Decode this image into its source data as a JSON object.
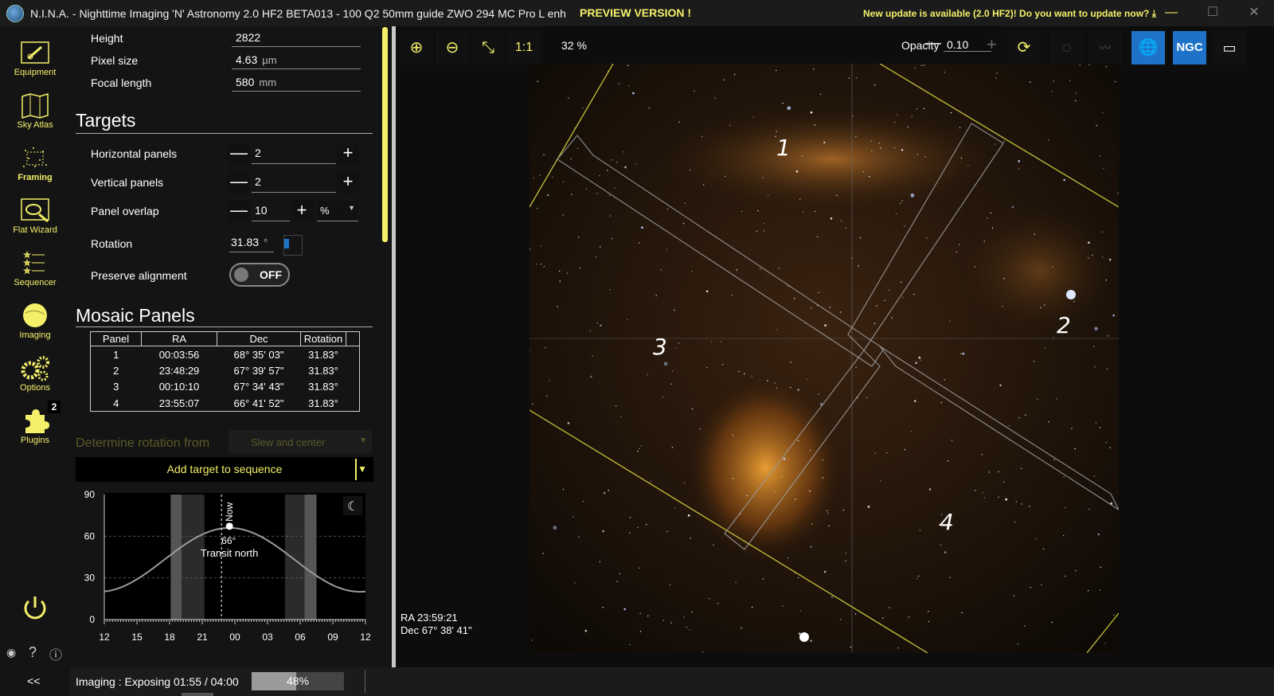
{
  "titlebar": {
    "title": "N.I.N.A. - Nighttime Imaging 'N' Astronomy 2.0 HF2 BETA013  -  100 Q2 50mm guide ZWO 294 MC Pro L enh",
    "preview": "PREVIEW VERSION !",
    "update": "New update is available (2.0 HF2)! Do you want to update now? ⤓",
    "minimize": "—",
    "maximize": "☐",
    "close": "✕"
  },
  "nav": {
    "items": [
      {
        "label": "Equipment"
      },
      {
        "label": "Sky Atlas"
      },
      {
        "label": "Framing"
      },
      {
        "label": "Flat Wizard"
      },
      {
        "label": "Sequencer"
      },
      {
        "label": "Imaging"
      },
      {
        "label": "Options"
      },
      {
        "label": "Plugins",
        "badge": "2"
      }
    ],
    "collapse": "<<"
  },
  "camera": {
    "height_label": "Height",
    "height_value": "2822",
    "pixel_label": "Pixel size",
    "pixel_value": "4.63",
    "pixel_unit": "µm",
    "focal_label": "Focal length",
    "focal_value": "580",
    "focal_unit": "mm"
  },
  "targets": {
    "title": "Targets",
    "hpanels_label": "Horizontal panels",
    "hpanels_value": "2",
    "vpanels_label": "Vertical panels",
    "vpanels_value": "2",
    "overlap_label": "Panel overlap",
    "overlap_value": "10",
    "overlap_unit": "%",
    "rotation_label": "Rotation",
    "rotation_value": "31.83",
    "rotation_unit": "°",
    "preserve_label": "Preserve alignment",
    "preserve_value": "OFF",
    "minus": "—",
    "plus": "+"
  },
  "mosaic": {
    "title": "Mosaic Panels",
    "headers": [
      "Panel",
      "RA",
      "Dec",
      "Rotation"
    ],
    "rows": [
      [
        "1",
        "00:03:56",
        "68° 35' 03\"",
        "31.83°"
      ],
      [
        "2",
        "23:48:29",
        "67° 39' 57\"",
        "31.83°"
      ],
      [
        "3",
        "00:10:10",
        "67° 34' 43\"",
        "31.83°"
      ],
      [
        "4",
        "23:55:07",
        "66° 41' 52\"",
        "31.83°"
      ]
    ]
  },
  "actions": {
    "determine_label": "Determine rotation from",
    "determine_value": "Slew and center",
    "add_target": "Add target to sequence"
  },
  "chart_data": {
    "type": "line",
    "title": "",
    "xlabel": "",
    "ylabel": "",
    "x_ticks": [
      "12",
      "15",
      "18",
      "21",
      "00",
      "03",
      "06",
      "09",
      "12"
    ],
    "y_ticks": [
      "90",
      "60",
      "30",
      "0"
    ],
    "ylim": [
      0,
      90
    ],
    "series": [
      {
        "values": [
          [
            12,
            21
          ],
          [
            15,
            30
          ],
          [
            18,
            45
          ],
          [
            21,
            60
          ],
          [
            23.5,
            66
          ],
          [
            2,
            60
          ],
          [
            5,
            45
          ],
          [
            8,
            30
          ],
          [
            11,
            21
          ],
          [
            12,
            20
          ]
        ]
      }
    ],
    "annotations": {
      "now": "Now",
      "altitude": "66°",
      "transit": "Transit north"
    },
    "moon_icon": "moon-icon"
  },
  "status": {
    "text": "Imaging :   Exposing 01:55 / 04:00",
    "progress": 0.48,
    "progress_text": "48%"
  },
  "viewer": {
    "zoom_in": "⊕",
    "zoom_out": "⊖",
    "fit": "⤡",
    "one_to_one": "1:1",
    "zoom_pct": "32 %",
    "opacity_label": "Opacity",
    "opacity_value": "0.10",
    "ngc": "NGC",
    "panel_numbers": [
      "1",
      "2",
      "3",
      "4"
    ],
    "ra": "RA 23:59:21",
    "dec": "Dec 67° 38' 41\""
  },
  "colors": {
    "accent": "#f4f06a",
    "select": "#1e73c8"
  }
}
